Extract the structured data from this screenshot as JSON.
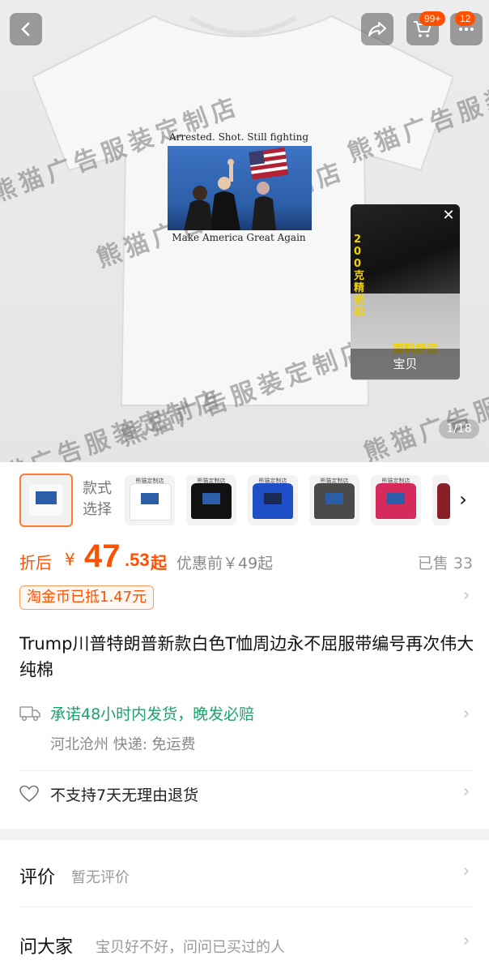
{
  "hero": {
    "print_top_text": "Arrested. Shot. Still fighting",
    "print_bottom_text": "Make America Great Again",
    "watermark": "熊猫广告服装定制店",
    "pager": "1/18",
    "cart_badge": "99+",
    "msg_badge": "12",
    "video": {
      "vertical_text": "200克精梳棉",
      "overlay_text": "面料舒适",
      "caption": "宝贝"
    }
  },
  "variants": {
    "label_line1": "款式",
    "label_line2": "选择",
    "swatch_caption": "熊猫定制店",
    "swatches": [
      {
        "color": "#ffffff"
      },
      {
        "color": "#111111"
      },
      {
        "color": "#1f4fc7"
      },
      {
        "color": "#4a4a4a"
      },
      {
        "color": "#d62a5c"
      }
    ]
  },
  "price": {
    "after_label": "折后",
    "currency": "¥",
    "integer": "47",
    "decimal": ".53",
    "suffix": "起",
    "before_text": "优惠前￥49起",
    "sold_text": "已售 33"
  },
  "coin": {
    "text": "淘金币已抵1.47元"
  },
  "product": {
    "title": "Trump川普特朗普新款白色T恤周边永不屈服带编号再次伟大纯棉"
  },
  "shipping": {
    "promise": "承诺48小时内发货，晚发必赔",
    "detail": "河北沧州  快递: 免运费"
  },
  "returns": {
    "text": "不支持7天无理由退货"
  },
  "reviews": {
    "title": "评价",
    "subtitle": "暂无评价"
  },
  "qa": {
    "title": "问大家",
    "subtitle": "宝贝好不好，问问已买过的人"
  },
  "colors": {
    "accent": "#ff5000",
    "ship_green": "#1aa36a"
  }
}
